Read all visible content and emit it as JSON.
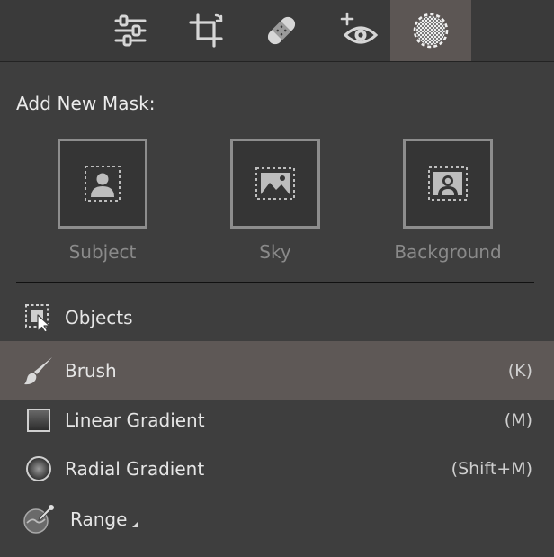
{
  "toolbar": {
    "tools": [
      {
        "icon": "sliders-icon"
      },
      {
        "icon": "crop-icon"
      },
      {
        "icon": "bandage-icon"
      },
      {
        "icon": "red-eye-icon"
      },
      {
        "icon": "masking-icon",
        "active": true
      }
    ]
  },
  "panel": {
    "add_title": "Add New Mask:",
    "quick_masks": [
      {
        "label": "Subject",
        "icon": "subject-icon"
      },
      {
        "label": "Sky",
        "icon": "sky-icon"
      },
      {
        "label": "Background",
        "icon": "background-icon"
      }
    ],
    "tools": [
      {
        "label": "Objects",
        "shortcut": "",
        "icon": "objects-icon"
      },
      {
        "label": "Brush",
        "shortcut": "(K)",
        "icon": "brush-icon",
        "highlighted": true
      },
      {
        "label": "Linear Gradient",
        "shortcut": "(M)",
        "icon": "linear-gradient-icon"
      },
      {
        "label": "Radial Gradient",
        "shortcut": "(Shift+M)",
        "icon": "radial-gradient-icon"
      },
      {
        "label": "Range",
        "shortcut": "",
        "icon": "range-icon",
        "has_submenu": true
      }
    ]
  },
  "colors": {
    "panel_bg": "#3e3e3e",
    "toolbar_bg": "#3a3a3a",
    "active_tool_bg": "#5c5654",
    "highlight_row_bg": "#5e5856",
    "tile_border": "#8d8d8d",
    "disabled_text": "#8a8a8a"
  }
}
